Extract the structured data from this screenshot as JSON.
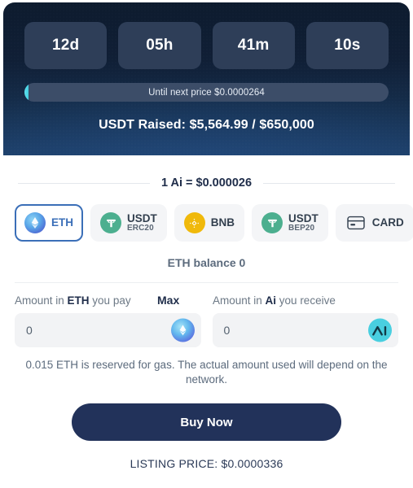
{
  "countdown": {
    "units": [
      {
        "name": "days",
        "value": "12d"
      },
      {
        "name": "hours",
        "value": "05h"
      },
      {
        "name": "minutes",
        "value": "41m"
      },
      {
        "name": "seconds",
        "value": "10s"
      }
    ]
  },
  "progress": {
    "label": "Until next price $0.0000264",
    "percent": 1.2,
    "fill_color": "#5de1ef",
    "track_color": "#3c4d68"
  },
  "raised": {
    "text": "USDT Raised: $5,564.99 / $650,000",
    "current": "$5,564.99",
    "goal": "$650,000"
  },
  "rate": {
    "text": "1 Ai = $0.000026"
  },
  "payment_methods": [
    {
      "id": "eth",
      "label": "ETH",
      "sub": "",
      "icon": "eth-icon",
      "selected": true,
      "color": "#5aa7e8"
    },
    {
      "id": "usdt-erc20",
      "label": "USDT",
      "sub": "ERC20",
      "icon": "usdt-icon",
      "selected": false,
      "color": "#4caf8f"
    },
    {
      "id": "bnb",
      "label": "BNB",
      "sub": "",
      "icon": "bnb-icon",
      "selected": false,
      "color": "#f0b90b"
    },
    {
      "id": "usdt-bep20",
      "label": "USDT",
      "sub": "BEP20",
      "icon": "usdt-icon",
      "selected": false,
      "color": "#4caf8f"
    },
    {
      "id": "card",
      "label": "CARD",
      "sub": "",
      "icon": "card-icon",
      "selected": false,
      "color": "#33404f"
    }
  ],
  "balance": {
    "text": "ETH balance 0"
  },
  "pay": {
    "label_prefix": "Amount in ",
    "label_token": "ETH",
    "label_suffix": " you pay",
    "max_label": "Max",
    "value": "0",
    "placeholder": "0",
    "coin_icon": "eth-icon"
  },
  "receive": {
    "label_prefix": "Amount in ",
    "label_token": "Ai",
    "label_suffix": " you receive",
    "value": "0",
    "placeholder": "0",
    "coin_icon": "ai-icon"
  },
  "gas_note": {
    "text": "0.015 ETH is reserved for gas. The actual amount used will depend on the network."
  },
  "buy": {
    "label": "Buy Now",
    "color": "#22325a"
  },
  "listing": {
    "text": "LISTING PRICE: $0.0000336"
  }
}
